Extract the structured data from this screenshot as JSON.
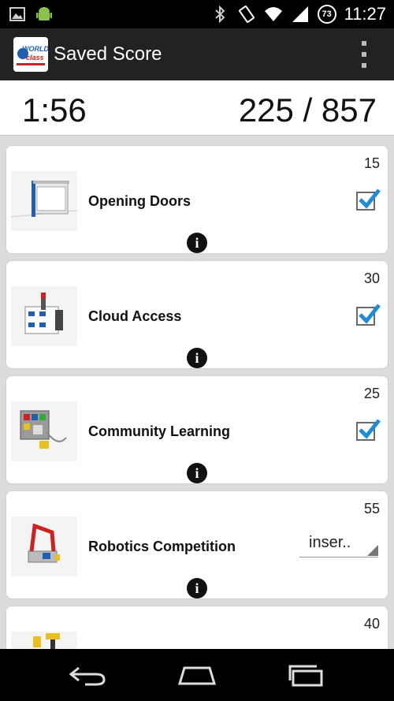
{
  "status_bar": {
    "time": "11:27",
    "battery_level": "73",
    "icons": [
      "image-icon",
      "android-icon",
      "bluetooth-icon",
      "vibrate-icon",
      "wifi-icon",
      "signal-icon"
    ]
  },
  "action_bar": {
    "title": "Saved Score",
    "logo_text_1": "WORLD",
    "logo_text_2": "class"
  },
  "score_header": {
    "timer": "1:56",
    "score": "225 / 857"
  },
  "missions": [
    {
      "name": "Opening Doors",
      "points": "15",
      "control": "checkbox",
      "checked": true
    },
    {
      "name": "Cloud Access",
      "points": "30",
      "control": "checkbox",
      "checked": true
    },
    {
      "name": "Community Learning",
      "points": "25",
      "control": "checkbox",
      "checked": true
    },
    {
      "name": "Robotics Competition",
      "points": "55",
      "control": "spinner",
      "value": "inser.."
    },
    {
      "name": "",
      "points": "40",
      "control": "none"
    }
  ],
  "info_label": "i",
  "colors": {
    "check_blue": "#1e8cd8",
    "action_bar": "#222222",
    "background": "#dcdcdc"
  }
}
